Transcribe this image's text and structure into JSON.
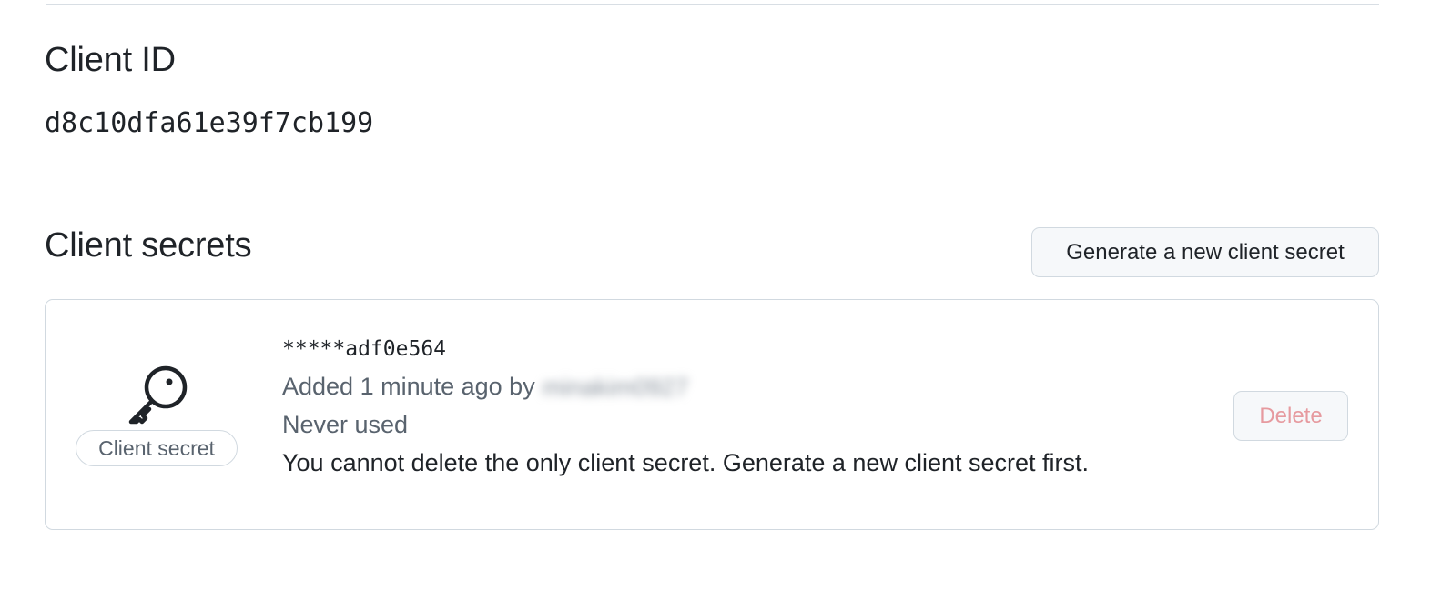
{
  "client_id": {
    "heading": "Client ID",
    "value": "d8c10dfa61e39f7cb199"
  },
  "client_secrets": {
    "heading": "Client secrets",
    "generate_button_label": "Generate a new client secret",
    "secret": {
      "label": "Client secret",
      "masked_value": "*****adf0e564",
      "added_text": "Added 1 minute ago by",
      "added_by": "minakim0927",
      "usage": "Never used",
      "note": "You cannot delete the only client secret. Generate a new client secret first.",
      "delete_button_label": "Delete"
    }
  },
  "icons": {
    "secret_icon": "key-icon"
  },
  "colors": {
    "text_primary": "#1f2328",
    "text_muted": "#59636e",
    "border": "#d1d9e0",
    "button_bg": "#f6f8fa",
    "danger_disabled": "#e69a9f"
  }
}
